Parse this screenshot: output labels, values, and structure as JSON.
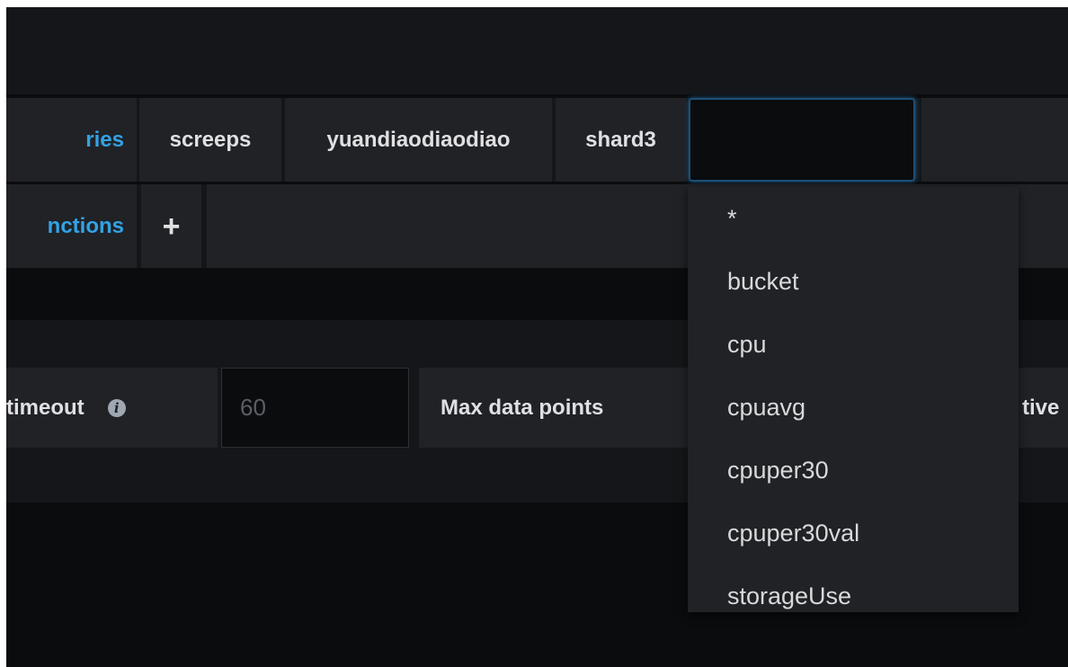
{
  "query_row": {
    "label": "ries",
    "segments": [
      "screeps",
      "yuandiaodiaodiao",
      "shard3"
    ],
    "active_input_value": ""
  },
  "functions_row": {
    "label": "nctions",
    "add_icon": "plus-icon",
    "add_symbol": "+"
  },
  "options": {
    "timeout_label": "timeout",
    "info_icon": "info-icon",
    "info_symbol": "i",
    "timeout_value": "60",
    "max_points_label": "Max data points",
    "truncated_label": "tive"
  },
  "dropdown": {
    "items": [
      "*",
      "bucket",
      "cpu",
      "cpuavg",
      "cpuper30",
      "cpuper30val",
      "storageUse"
    ]
  },
  "colors": {
    "background": "#0b0c0e",
    "segment": "#202226",
    "keyword_blue": "#33a2e5",
    "text": "#e0e0e3"
  }
}
